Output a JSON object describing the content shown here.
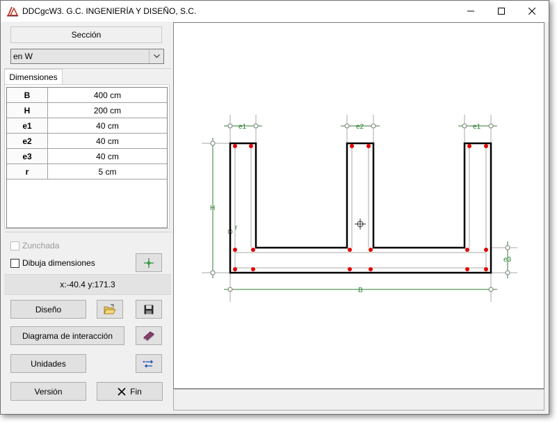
{
  "window": {
    "title": "DDCgcW3. G.C. INGENIERÍA Y DISEÑO, S.C.",
    "icon": "app-logo-icon"
  },
  "section": {
    "header": "Sección",
    "selected": "en W"
  },
  "tabs": [
    {
      "label": "Dimensiones",
      "active": true
    }
  ],
  "dimensions": [
    {
      "key": "B",
      "value": "400 cm"
    },
    {
      "key": "H",
      "value": "200 cm"
    },
    {
      "key": "e1",
      "value": "40 cm"
    },
    {
      "key": "e2",
      "value": "40 cm"
    },
    {
      "key": "e3",
      "value": "40 cm"
    },
    {
      "key": "r",
      "value": "5 cm"
    }
  ],
  "options": {
    "zunchada": {
      "label": "Zunchada",
      "checked": false,
      "enabled": false
    },
    "dibuja_dimensiones": {
      "label": "Dibuja dimensiones",
      "checked": false
    }
  },
  "coords": "x:-40.4 y:171.3",
  "buttons": {
    "diseno": "Diseño",
    "diagrama": "Diagrama de interacción",
    "unidades": "Unidades",
    "version": "Versión",
    "fin": "Fin"
  },
  "icons": {
    "add_point": "green-point-icon",
    "open": "open-folder-icon",
    "save": "save-disk-icon",
    "book": "book-icon",
    "units": "arrows-icon",
    "close": "x-icon"
  },
  "drawing": {
    "labels": {
      "B": "B",
      "H": "H",
      "e1_left": "e1",
      "e2": "e2",
      "e1_right": "e1",
      "e3": "e3",
      "r": "r"
    },
    "colors": {
      "outline": "#000000",
      "dims": "#2e7d32",
      "rebar": "#e00000",
      "guide": "#a8a8a8"
    }
  }
}
